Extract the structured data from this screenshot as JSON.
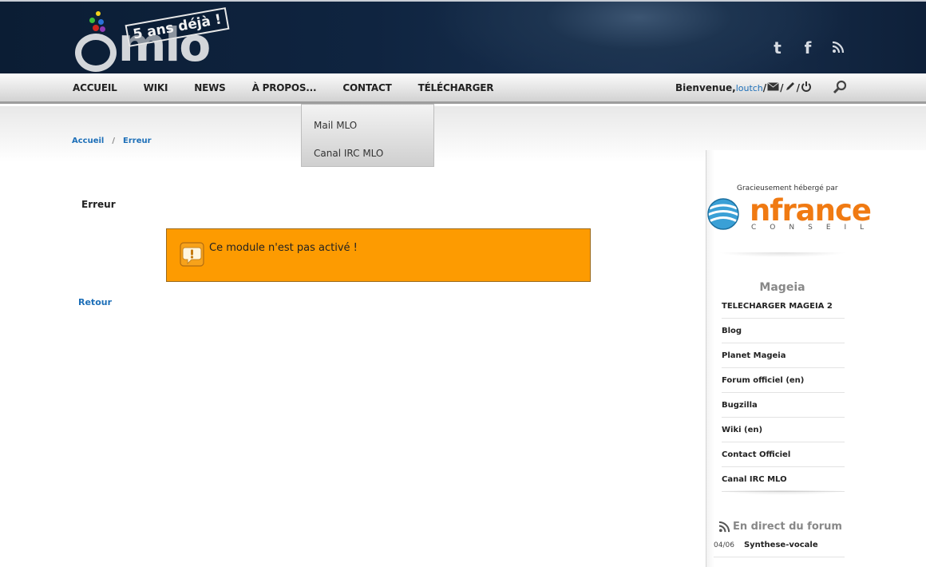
{
  "header": {
    "logo_text": "mlo",
    "logo_stamp": "5 ans déjà !",
    "social_icons": [
      "twitter-icon",
      "facebook-icon",
      "rss-icon"
    ]
  },
  "menu": {
    "items": [
      "ACCUEIL",
      "WIKI",
      "NEWS",
      "À PROPOS...",
      "CONTACT",
      "TÉLÉCHARGER"
    ]
  },
  "dropdown": {
    "items": [
      "Mail MLO",
      "Canal IRC MLO"
    ]
  },
  "user": {
    "greeting": "Bienvenue,",
    "username": "loutch",
    "separator": "/"
  },
  "breadcrumb": {
    "home": "Accueil",
    "separator": "/",
    "current": "Erreur"
  },
  "main": {
    "title": "Erreur",
    "alert_message": "Ce module n'est pas activé !",
    "back_link": "Retour"
  },
  "sidebar": {
    "sponsor_label": "Gracieusement hébergé par",
    "sponsor_name": "nfrance",
    "sponsor_sub": "CONSEIL",
    "mageia_title": "Mageia",
    "links": [
      "TELECHARGER MAGEIA 2",
      "Blog",
      "Planet Mageia",
      "Forum officiel (en)",
      "Bugzilla",
      "Wiki (en)",
      "Contact Officiel",
      "Canal IRC MLO"
    ],
    "forum_title": "En direct du forum",
    "forum_posts": [
      {
        "date": "04/06",
        "topic": "Synthese-vocale"
      }
    ]
  },
  "colors": {
    "header_bg": "#0f2440",
    "link_blue": "#1d6fb8",
    "alert_orange": "#fd9b01",
    "sponsor_orange": "#f07a12"
  }
}
